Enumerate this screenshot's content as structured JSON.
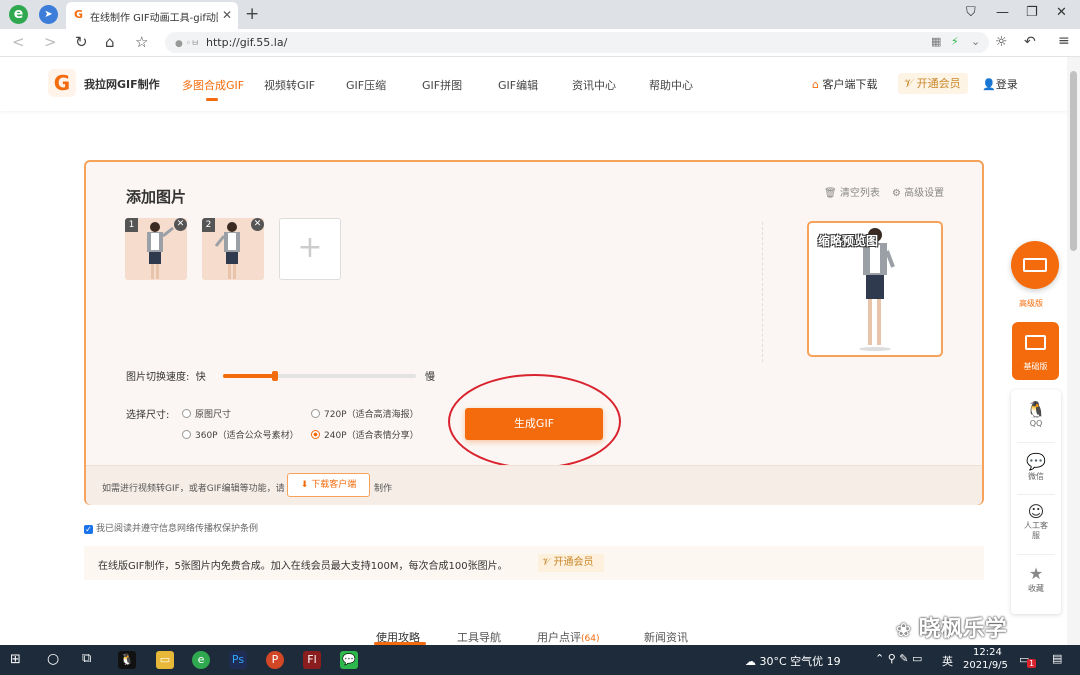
{
  "browser": {
    "tab_title": "在线制作 GIF动画工具-gif动图-",
    "tab_close": "✕",
    "new_tab": "+",
    "url": "http://gif.55.la/",
    "url_prefix": "●  ◦ㅂ"
  },
  "site": {
    "brand": "我拉网GIF制作",
    "nav": [
      "多图合成GIF",
      "视频转GIF",
      "GIF压缩",
      "GIF拼图",
      "GIF编辑",
      "资讯中心",
      "帮助中心"
    ],
    "client_download": "客户端下载",
    "vip": "开通会员",
    "login": "登录"
  },
  "editor": {
    "title": "添加图片",
    "clear_list": "清空列表",
    "advanced_settings": "高级设置",
    "thumbnails": [
      {
        "num": "1"
      },
      {
        "num": "2"
      }
    ],
    "add_symbol": "+",
    "preview_label": "缩略预览图",
    "speed_label": "图片切换速度:",
    "speed_fast": "快",
    "speed_slow": "慢",
    "speed_level": 0.27,
    "size_label": "选择尺寸:",
    "sizes": [
      {
        "label": "原图尺寸",
        "selected": false
      },
      {
        "label": "720P（适合高清海报）",
        "selected": false
      },
      {
        "label": "360P（适合公众号素材）",
        "selected": false
      },
      {
        "label": "240P（适合表情分享）",
        "selected": true
      }
    ],
    "generate": "生成GIF",
    "foot_text1": "如需进行视频转GIF，或者GIF编辑等功能，请",
    "download_client": "下载客户端",
    "foot_text2": "制作"
  },
  "agree": "我已阅读并遵守信息网络传播权保护条例",
  "notice": {
    "text": "在线版GIF制作，5张图片内免费合成。加入在线会员最大支持100M，每次合成100张图片。",
    "vip": "开通会员"
  },
  "bottom_tabs": [
    {
      "label": "使用攻略",
      "count": ""
    },
    {
      "label": "工具导航",
      "count": ""
    },
    {
      "label": "用户点评",
      "count": "(64)"
    },
    {
      "label": "新闻资讯",
      "count": ""
    }
  ],
  "watermark": "晓枫乐学",
  "sidebar": {
    "advanced": "高级版",
    "basic": "基础版",
    "qq": "QQ",
    "wechat": "微信",
    "human_service": "人工客服",
    "favorite": "收藏"
  },
  "taskbar": {
    "weather": "30°C  空气优 19",
    "lang": "英",
    "time": "12:24",
    "date": "2021/9/5",
    "notify": "1"
  },
  "colors": {
    "accent": "#f36b0c",
    "highlight_circle": "#d9232e"
  }
}
